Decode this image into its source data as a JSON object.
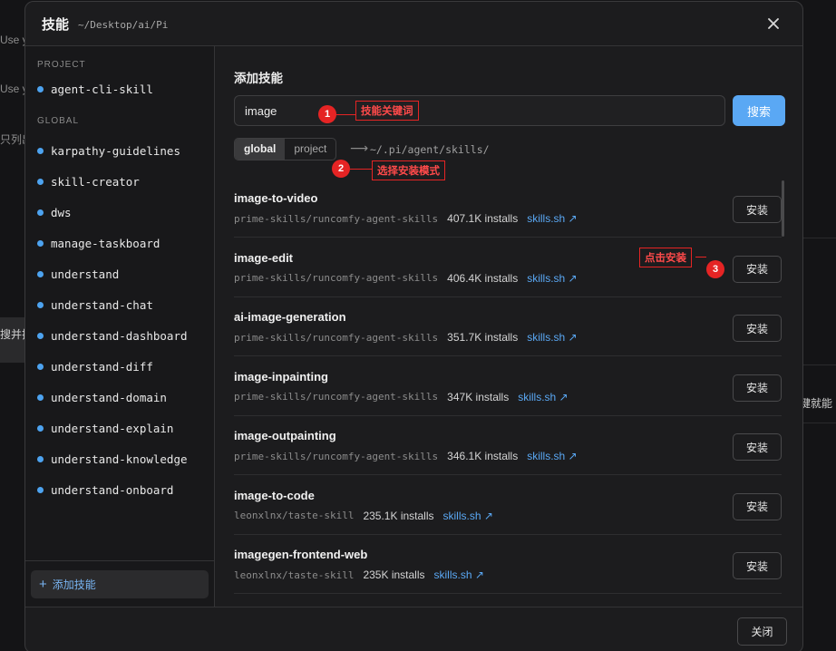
{
  "background": {
    "fragments": [
      "Use y",
      "Use y",
      "只列出",
      "搜并拉",
      "键就能"
    ]
  },
  "modal": {
    "title": "技能",
    "path": "~/Desktop/ai/Pi",
    "close_icon": "close-icon"
  },
  "sidebar": {
    "project_section": "PROJECT",
    "project_items": [
      "agent-cli-skill"
    ],
    "global_section": "GLOBAL",
    "global_items": [
      "karpathy-guidelines",
      "skill-creator",
      "dws",
      "manage-taskboard",
      "understand",
      "understand-chat",
      "understand-dashboard",
      "understand-diff",
      "understand-domain",
      "understand-explain",
      "understand-knowledge",
      "understand-onboard"
    ],
    "add_button_icon": "+",
    "add_button_label": "添加技能"
  },
  "main": {
    "title": "添加技能",
    "search": {
      "value": "image",
      "button_label": "搜索"
    },
    "scope": {
      "options": [
        "global",
        "project"
      ],
      "selected": "global",
      "arrow": "⟶",
      "path": "~/.pi/agent/skills/"
    },
    "annotations": [
      {
        "num": "1",
        "label": "技能关键词"
      },
      {
        "num": "2",
        "label": "选择安装模式"
      },
      {
        "num": "3",
        "label": "点击安装"
      }
    ],
    "results": [
      {
        "name": "image-to-video",
        "source": "prime-skills/runcomfy-agent-skills",
        "installs": "407.1K installs",
        "link": "skills.sh ↗",
        "button": "安装"
      },
      {
        "name": "image-edit",
        "source": "prime-skills/runcomfy-agent-skills",
        "installs": "406.4K installs",
        "link": "skills.sh ↗",
        "button": "安装"
      },
      {
        "name": "ai-image-generation",
        "source": "prime-skills/runcomfy-agent-skills",
        "installs": "351.7K installs",
        "link": "skills.sh ↗",
        "button": "安装"
      },
      {
        "name": "image-inpainting",
        "source": "prime-skills/runcomfy-agent-skills",
        "installs": "347K installs",
        "link": "skills.sh ↗",
        "button": "安装"
      },
      {
        "name": "image-outpainting",
        "source": "prime-skills/runcomfy-agent-skills",
        "installs": "346.1K installs",
        "link": "skills.sh ↗",
        "button": "安装"
      },
      {
        "name": "image-to-code",
        "source": "leonxlnx/taste-skill",
        "installs": "235.1K installs",
        "link": "skills.sh ↗",
        "button": "安装"
      },
      {
        "name": "imagegen-frontend-web",
        "source": "leonxlnx/taste-skill",
        "installs": "235K installs",
        "link": "skills.sh ↗",
        "button": "安装"
      }
    ]
  },
  "footer": {
    "close_label": "关闭"
  },
  "colors": {
    "accent": "#5aa8f4",
    "annotation": "#e52424",
    "dot": "#4da3f0"
  }
}
